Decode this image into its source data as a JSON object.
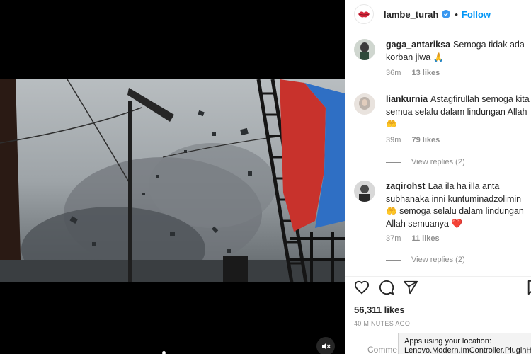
{
  "post": {
    "username": "lambe_turah",
    "follow_label": "Follow",
    "separator": "•",
    "likes": "56,311 likes",
    "time_ago": "40 MINUTES AGO",
    "comment_placeholder": "Comme"
  },
  "comments": [
    {
      "username": "gaga_antariksa",
      "text": "Semoga tidak ada korban jiwa",
      "emoji": "🙏",
      "time": "36m",
      "likes": "13 likes"
    },
    {
      "username": "liankurnia",
      "text": "Astagfirullah semoga kita semua selalu dalam lindungan Allah",
      "emoji": "🤲",
      "time": "39m",
      "likes": "79 likes",
      "view_replies": "View replies (2)"
    },
    {
      "username": "zaqirohst",
      "text": "Laa ila ha illa anta subhanaka inni kuntuminadzolimin",
      "emoji": "🤲",
      "text2": "semoga selalu dalam lindungan Allah semuanya",
      "emoji2": "❤️",
      "time": "37m",
      "likes": "11 likes",
      "view_replies": "View replies (2)"
    }
  ],
  "notification": {
    "line1": "Apps using your location:",
    "line2": "Lenovo.Modern.ImController.PluginHo"
  },
  "colors": {
    "follow": "#0095f6",
    "verified": "#3897f0",
    "meta_text": "#8e8e8e",
    "heart_emoji": "#e0245e"
  },
  "icons": [
    "verified-badge-icon",
    "heart-icon",
    "comment-icon",
    "share-icon",
    "bookmark-icon",
    "mute-icon"
  ]
}
